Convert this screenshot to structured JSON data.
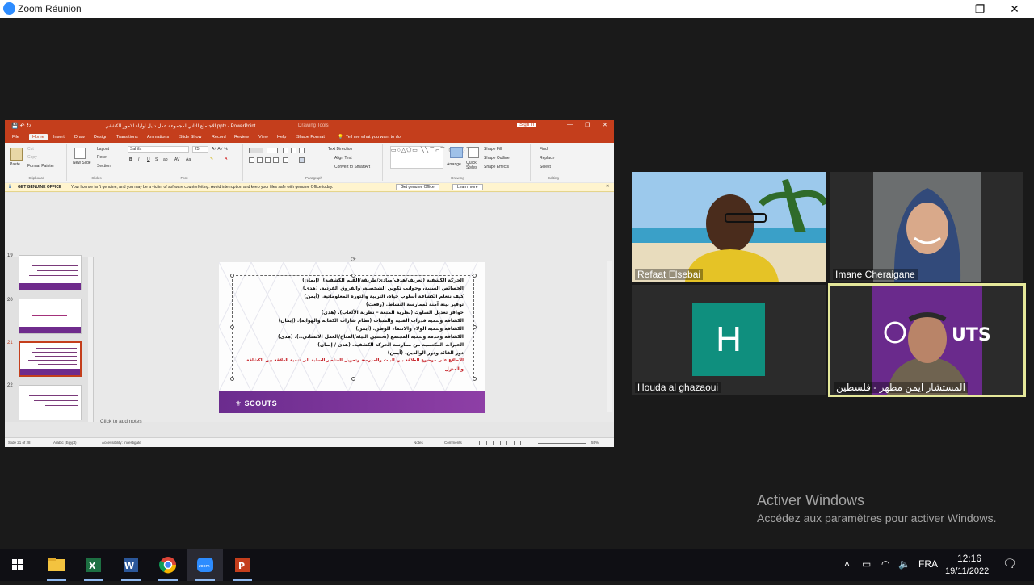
{
  "zoom": {
    "window_title": "Zoom Réunion",
    "minimize": "—",
    "restore": "❐",
    "close": "✕"
  },
  "ppt": {
    "title": "الاجتماع الثاني لمجموعة عمل دليل اولياء الامور الكشفي.pptx - PowerPoint",
    "drawing_tools": "Drawing Tools",
    "sign_in": "Sign in",
    "tell_me": "Tell me what you want to do",
    "tabs": [
      "File",
      "Home",
      "Insert",
      "Draw",
      "Design",
      "Transitions",
      "Animations",
      "Slide Show",
      "Record",
      "Review",
      "View",
      "Help",
      "Shape Format"
    ],
    "ribbon": {
      "paste": "Paste",
      "cut": "Cut",
      "copy": "Copy",
      "format_painter": "Format Painter",
      "clipboard": "Clipboard",
      "new_slide": "New Slide",
      "layout": "Layout",
      "reset": "Reset",
      "section": "Section",
      "slides": "Slides",
      "font_name": "Sahifa",
      "font_size": "25",
      "font": "Font",
      "text_direction": "Text Direction",
      "align_text": "Align Text",
      "convert_smartart": "Convert to SmartArt",
      "paragraph": "Paragraph",
      "arrange": "Arrange",
      "quick_styles": "Quick Styles",
      "shape_fill": "Shape Fill",
      "shape_outline": "Shape Outline",
      "shape_effects": "Shape Effects",
      "drawing": "Drawing",
      "find": "Find",
      "replace": "Replace",
      "select": "Select",
      "editing": "Editing"
    },
    "warning": {
      "title": "GET GENUINE OFFICE",
      "message": "Your license isn't genuine, and you may be a victim of software counterfeiting. Avoid interruption and keep your files safe with genuine Office today.",
      "button1": "Get genuine Office",
      "button2": "Learn more"
    },
    "thumbs": [
      {
        "num": "19"
      },
      {
        "num": "20"
      },
      {
        "num": "21"
      },
      {
        "num": "22"
      }
    ],
    "slide_lines": [
      {
        "text": "الحركة الكشفية (تعريف/هدف/مبادئ/طريقة/القيم الكشفية). (إيمان)"
      },
      {
        "text": "الخصائص السنية، وجوانب تكوين الشخصية، والفروق الفردية. (هدى)"
      },
      {
        "text": "كيف نتعلم الكشافة أسلوب حياة، التربية والثورة المعلوماتية. (أيمن)"
      },
      {
        "text": "توفير بيئة آمنة لممارسة النشاط. (رفعت)"
      },
      {
        "text": "حوافز تعديل السلوك (نظرية المتعة – نظرية الألعاب). (هدى)"
      },
      {
        "text": "الكشافة وتنمية قدرات الفتية والشباب (نظام شارات الكفاية والهواية). (إيمان)"
      },
      {
        "text": "الكشافة وتنمية الولاء والانتماء للوطن. (أيمن)"
      },
      {
        "text": "الكشافة وخدمة وتنمية المجتمع (تحسين البيئة/المناخ/العمل الانساني..). (هدى)"
      },
      {
        "text": "الخبرات المكتسبة من ممارسة الحركة الكشفية. (هدى / إيمان)"
      },
      {
        "text": "دور القائد ودور الوالدين. (أيمن)"
      },
      {
        "text": "الاطلاع على موضوع العلاقة بين البيت والمدرسة وتحويل العناصر السلبة الى تنمية العلاقة بين الكشافة"
      },
      {
        "text": "والمنزل"
      }
    ],
    "slide_logo": "⚜ SCOUTS",
    "notes_placeholder": "Click to add notes",
    "status": {
      "slide": "Slide 21 of 28",
      "language": "Arabic (Egypt)",
      "accessibility": "Accessibility: Investigate",
      "notes": "Notes",
      "comments": "Comments",
      "zoom": "55%"
    }
  },
  "participants": [
    {
      "name": "Refaat Elsebai"
    },
    {
      "name": "Imane Cheraigane"
    },
    {
      "name": "Houda al ghazaoui",
      "initial": "H"
    },
    {
      "name": "المستشار ايمن مظهر - فلسطين"
    }
  ],
  "activate": {
    "title": "Activer Windows",
    "subtitle": "Accédez aux paramètres pour activer Windows."
  },
  "taskbar": {
    "language": "FRA",
    "time": "12:16",
    "date": "19/11/2022",
    "apps": [
      "windows-start",
      "file-explorer",
      "excel",
      "word",
      "chrome",
      "zoom",
      "powerpoint"
    ]
  },
  "colors": {
    "ppt_accent": "#c43e1c",
    "zoom_blue": "#2d8cff",
    "scouts_purple": "#6b2c8e",
    "avatar_teal": "#0f8f7e",
    "active_speaker": "#e5e89a"
  }
}
